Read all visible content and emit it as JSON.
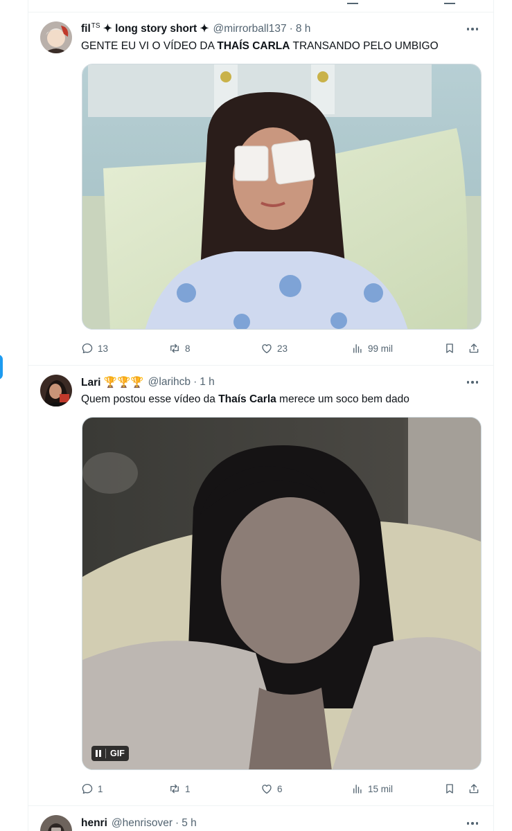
{
  "tweets": [
    {
      "display_name": "fil",
      "name_sup": "TS",
      "name_suffix": "✦ long story short ✦",
      "handle": "@mirrorball137",
      "time": "8 h",
      "text_before": "GENTE EU VI O VÍDEO DA ",
      "text_bold": "THAÍS CARLA",
      "text_after": " TRANSANDO PELO UMBIGO",
      "replies": "13",
      "reposts": "8",
      "likes": "23",
      "views": "99 mil"
    },
    {
      "display_name": "Lari",
      "name_suffix": "🏆🏆🏆",
      "handle": "@larihcb",
      "time": "1 h",
      "text_before": "Quem postou esse vídeo da ",
      "text_bold": "Thaís Carla",
      "text_after": " merece um soco bem dado",
      "gif_label": "GIF",
      "replies": "1",
      "reposts": "1",
      "likes": "6",
      "views": "15 mil"
    },
    {
      "display_name": "henri",
      "handle": "@henrisover",
      "time": "5 h"
    }
  ],
  "separator": "·",
  "icons": [
    "reply-icon",
    "repost-icon",
    "like-icon",
    "views-icon",
    "bookmark-icon",
    "share-icon",
    "more-icon"
  ],
  "colors": {
    "text": "#0f1419",
    "secondary": "#536471",
    "border": "#eff3f4",
    "accent": "#1d9bf0"
  }
}
